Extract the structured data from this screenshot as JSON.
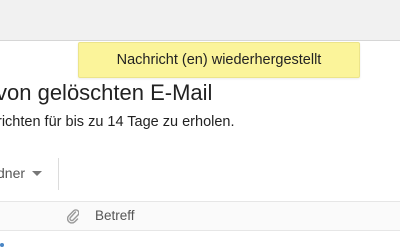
{
  "toast": {
    "message": "Nachricht (en) wiederhergestellt",
    "color": "#fbf49a"
  },
  "header": {
    "title": "von gelöschten E-Mail",
    "subtitle": "richten für bis zu 14 Tage zu erholen."
  },
  "toolbar": {
    "folder_label": "dner",
    "folder_icon": "chevron-down-icon"
  },
  "table": {
    "columns": [
      {
        "icon": "paperclip-icon",
        "label": "Betreff"
      }
    ]
  },
  "colors": {
    "accent": "#4a86c5",
    "topbar": "#f1f1f1"
  }
}
